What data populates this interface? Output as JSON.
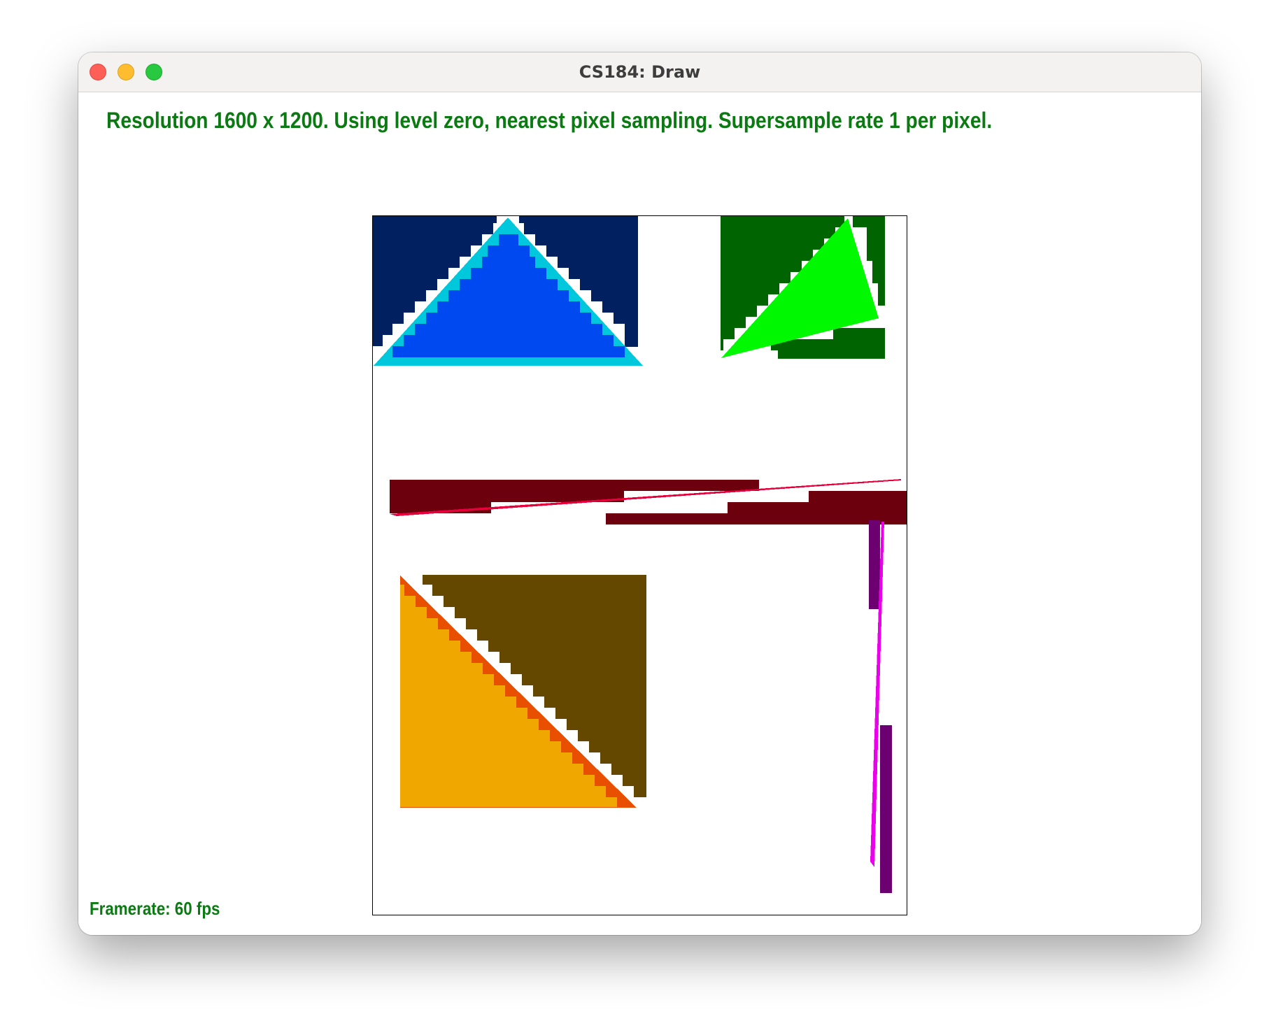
{
  "window": {
    "title": "CS184: Draw"
  },
  "status": {
    "text": "Resolution 1600 x 1200. Using level zero, nearest pixel sampling. Supersample rate 1 per pixel."
  },
  "footer": {
    "framerate": "Framerate: 60 fps"
  },
  "colors": {
    "status_text": "#0b7a12",
    "navy": "#00205f",
    "cyan": "#00c8dc",
    "blue": "#0048f0",
    "dark_green": "#006400",
    "bright_green": "#00f800",
    "maroon": "#6c000c",
    "red": "#e8003c",
    "purple": "#6c0070",
    "magenta": "#ea00ea",
    "olive": "#644800",
    "orange": "#f0a800",
    "orange_edge": "#e85000"
  },
  "icons": {
    "close": "close-icon",
    "minimize": "minimize-icon",
    "maximize": "maximize-icon"
  }
}
